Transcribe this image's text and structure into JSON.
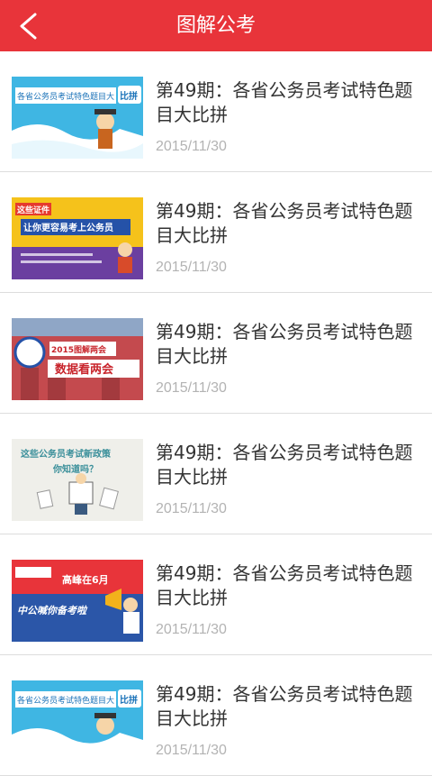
{
  "header": {
    "title": "图解公考",
    "back_icon": "chevron-left-icon"
  },
  "articles": [
    {
      "title": "第49期：各省公务员考试特色题目大比拼",
      "date": "2015/11/30",
      "thumb_text_1": "各省公务员考试特色题目大",
      "thumb_text_2": "比拼"
    },
    {
      "title": "第49期：各省公务员考试特色题目大比拼",
      "date": "2015/11/30",
      "thumb_text_1": "这些证件",
      "thumb_text_2": "让你更容易考上公务员"
    },
    {
      "title": "第49期：各省公务员考试特色题目大比拼",
      "date": "2015/11/30",
      "thumb_text_1": "2015图解两会",
      "thumb_text_2": "数据看两会"
    },
    {
      "title": "第49期：各省公务员考试特色题目大比拼",
      "date": "2015/11/30",
      "thumb_text_1": "这些公务员考试新政策",
      "thumb_text_2": "你知道吗？"
    },
    {
      "title": "第49期：各省公务员考试特色题目大比拼",
      "date": "2015/11/30",
      "thumb_text_1": "高峰在6月",
      "thumb_text_2": "中公喊你备考啦"
    },
    {
      "title": "第49期：各省公务员考试特色题目大比拼",
      "date": "2015/11/30",
      "thumb_text_1": "各省公务员考试特色题目大",
      "thumb_text_2": "比拼"
    }
  ]
}
